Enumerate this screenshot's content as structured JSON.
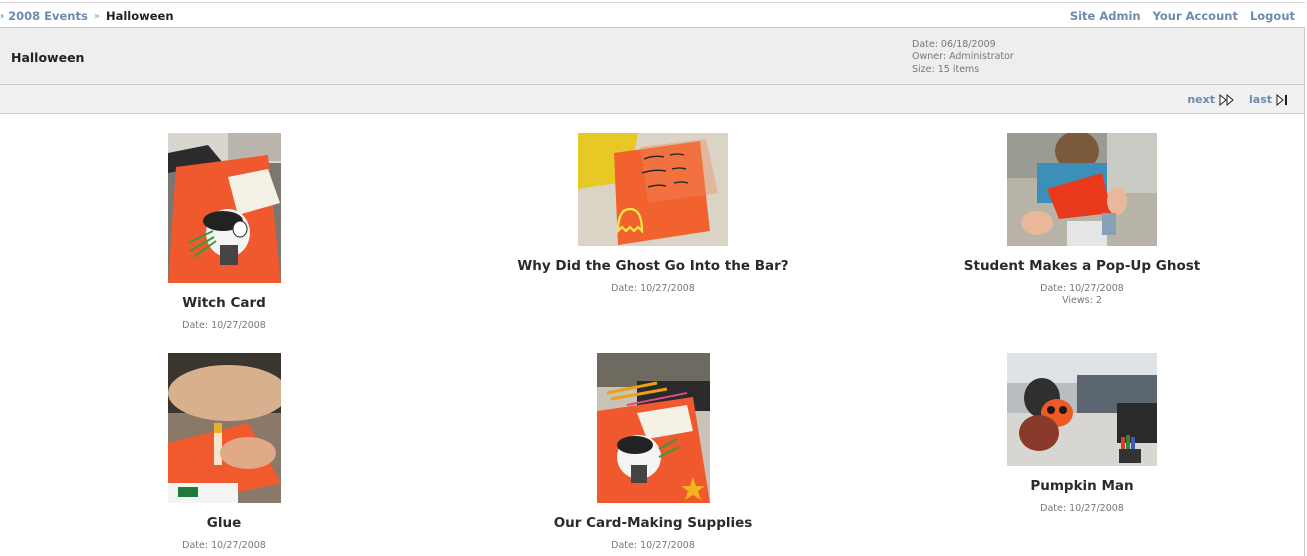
{
  "breadcrumb": {
    "parent": "2008 Events",
    "current": "Halloween"
  },
  "usernav": {
    "site_admin": "Site Admin",
    "your_account": "Your Account",
    "logout": "Logout"
  },
  "album": {
    "title": "Halloween",
    "date": "Date: 06/18/2009",
    "owner": "Owner: Administrator",
    "size": "Size: 15 items"
  },
  "pager": {
    "next": "next",
    "last": "last"
  },
  "items": [
    {
      "title": "Witch Card",
      "date": "Date: 10/27/2008",
      "views": ""
    },
    {
      "title": "Why Did the Ghost Go Into the Bar?",
      "date": "Date: 10/27/2008",
      "views": ""
    },
    {
      "title": "Student Makes a Pop-Up Ghost",
      "date": "Date: 10/27/2008",
      "views": "Views: 2"
    },
    {
      "title": "Glue",
      "date": "Date: 10/27/2008",
      "views": ""
    },
    {
      "title": "Our Card-Making Supplies",
      "date": "Date: 10/27/2008",
      "views": ""
    },
    {
      "title": "Pumpkin Man",
      "date": "Date: 10/27/2008",
      "views": ""
    }
  ],
  "colors": {
    "link": "#6d8ab0",
    "header_bg": "#eeeeee",
    "card_orange": "#f0592e"
  },
  "icons": {
    "next": "next-arrow-icon",
    "last": "last-arrow-icon"
  }
}
